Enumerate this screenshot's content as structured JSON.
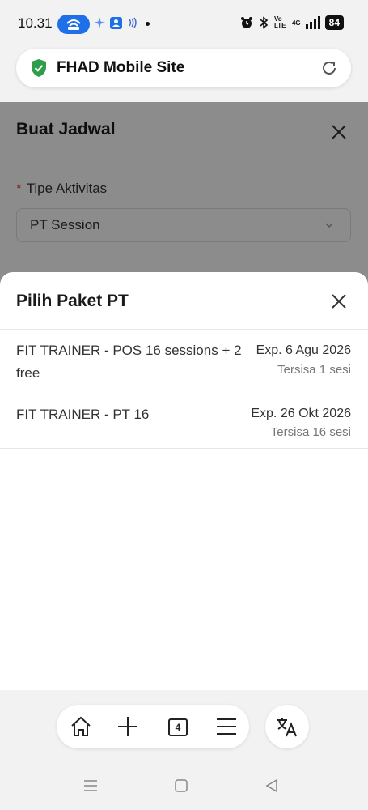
{
  "status_bar": {
    "time": "10.31",
    "network": "Vo LTE",
    "signal": "4G",
    "battery": "84"
  },
  "browser": {
    "site_title": "FHAD Mobile Site",
    "tabs_count": "4",
    "icons": [
      "shield-check-icon",
      "reload-icon",
      "home-icon",
      "plus-icon",
      "tabs-icon",
      "menu-icon",
      "translate-icon"
    ]
  },
  "form": {
    "title": "Buat Jadwal",
    "activity_label": "Tipe Aktivitas",
    "required_marker": "*",
    "activity_value": "PT Session"
  },
  "sheet": {
    "title": "Pilih Paket PT",
    "packages": [
      {
        "name": "FIT TRAINER - POS 16 sessions + 2 free",
        "expiry": "Exp. 6 Agu 2026",
        "remaining": "Tersisa 1 sesi"
      },
      {
        "name": "FIT TRAINER - PT 16",
        "expiry": "Exp. 26 Okt 2026",
        "remaining": "Tersisa 16 sesi"
      }
    ]
  },
  "colors": {
    "accent": "#1e6fe8",
    "shield": "#2e9e4a",
    "required": "#e04040"
  }
}
